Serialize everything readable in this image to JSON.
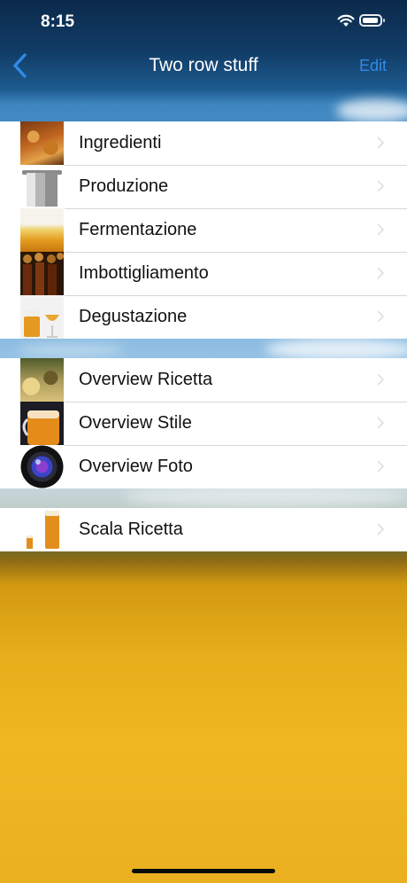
{
  "status_bar": {
    "time": "8:15"
  },
  "nav": {
    "title": "Two row stuff",
    "edit_label": "Edit"
  },
  "sections": [
    {
      "rows": [
        {
          "label": "Ingredienti",
          "icon": "grain-icon"
        },
        {
          "label": "Produzione",
          "icon": "pot-icon"
        },
        {
          "label": "Fermentazione",
          "icon": "foam-icon"
        },
        {
          "label": "Imbottigliamento",
          "icon": "bottles-icon"
        },
        {
          "label": "Degustazione",
          "icon": "glasses-icon"
        }
      ]
    },
    {
      "rows": [
        {
          "label": "Overview Ricetta",
          "icon": "recipe-icon"
        },
        {
          "label": "Overview Stile",
          "icon": "pitcher-icon"
        },
        {
          "label": "Overview Foto",
          "icon": "camera-lens-icon"
        }
      ]
    },
    {
      "rows": [
        {
          "label": "Scala Ricetta",
          "icon": "beer-scale-icon"
        }
      ]
    }
  ],
  "colors": {
    "accent": "#2f8be6",
    "separator": "#d6d6d6"
  }
}
